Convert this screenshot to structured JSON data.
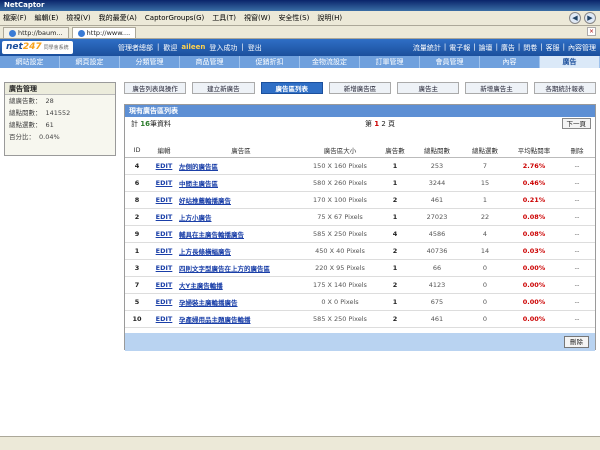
{
  "window": {
    "title": "NetCaptor"
  },
  "menu": [
    "檔案(F)",
    "編輯(E)",
    "檢視(V)",
    "我的最愛(A)",
    "CaptorGroups(G)",
    "工具(T)",
    "視窗(W)",
    "安全性(S)",
    "說明(H)"
  ],
  "browser_tabs": [
    {
      "label": "http://baum..."
    },
    {
      "label": "http://www...."
    }
  ],
  "header": {
    "logo_main": "net",
    "logo_num": "247",
    "logo_sub": "同學會系統",
    "system_name": "管理者總部",
    "sep": "|",
    "greeting_prefix": "歡迎",
    "username": "aileen",
    "greeting_suffix": "登入成功",
    "logout": "登出",
    "links": [
      "流量統計",
      "|",
      "電子報",
      "|",
      "論壇",
      "|",
      "廣告",
      "|",
      "問卷",
      "|",
      "客服",
      "|",
      "內容管理"
    ]
  },
  "main_nav": [
    "網站設定",
    "網頁設定",
    "分類管理",
    "商品管理",
    "促銷折扣",
    "金物流設定",
    "訂單管理",
    "會員管理",
    "內容",
    "廣告"
  ],
  "sidebar": {
    "title": "廣告管理",
    "rows": [
      {
        "label": "總廣告數：",
        "value": "28"
      },
      {
        "label": "總點閱數：",
        "value": "141552"
      },
      {
        "label": "總點選數：",
        "value": "61"
      },
      {
        "label": "百分比：",
        "value": "0.04%"
      }
    ]
  },
  "subtabs": [
    "廣告列表與操作",
    "建立新廣告",
    "廣告區列表",
    "新增廣告區",
    "廣告主",
    "新增廣告主",
    "各期統計報表"
  ],
  "panel": {
    "title": "現有廣告區列表",
    "count_prefix": "計",
    "count_value": "16",
    "count_suffix": "筆資料",
    "page_prefix": "第",
    "page_current": "1",
    "page_other": "2",
    "page_suffix": "頁",
    "next_label": "下一頁",
    "delete_label": "刪除"
  },
  "table": {
    "headers": [
      "ID",
      "編輯",
      "廣告區",
      "廣告區大小",
      "廣告數",
      "總點閱數",
      "總點選數",
      "平均點閱率",
      "刪除"
    ],
    "rows": [
      {
        "id": "4",
        "edit": "EDIT",
        "name": "左側的廣告區",
        "size": "150 X 160 Pixels",
        "ads": "1",
        "views": "253",
        "clicks": "7",
        "rate": "2.76%",
        "del": "--"
      },
      {
        "id": "6",
        "edit": "EDIT",
        "name": "中間主廣告區",
        "size": "580 X 260 Pixels",
        "ads": "1",
        "views": "3244",
        "clicks": "15",
        "rate": "0.46%",
        "del": "--"
      },
      {
        "id": "8",
        "edit": "EDIT",
        "name": "好站推薦輪播廣告",
        "size": "170 X 100 Pixels",
        "ads": "2",
        "views": "461",
        "clicks": "1",
        "rate": "0.21%",
        "del": "--"
      },
      {
        "id": "2",
        "edit": "EDIT",
        "name": "上方小廣告",
        "size": "75 X 67 Pixels",
        "ads": "1",
        "views": "27023",
        "clicks": "22",
        "rate": "0.08%",
        "del": "--"
      },
      {
        "id": "9",
        "edit": "EDIT",
        "name": "輔具在主廣告輪播廣告",
        "size": "585 X 250 Pixels",
        "ads": "4",
        "views": "4586",
        "clicks": "4",
        "rate": "0.08%",
        "del": "--"
      },
      {
        "id": "1",
        "edit": "EDIT",
        "name": "上方長條橫幅廣告",
        "size": "450 X 40 Pixels",
        "ads": "2",
        "views": "40736",
        "clicks": "14",
        "rate": "0.03%",
        "del": "--"
      },
      {
        "id": "3",
        "edit": "EDIT",
        "name": "四則文字型廣告在上方的廣告區",
        "size": "220 X 95 Pixels",
        "ads": "1",
        "views": "66",
        "clicks": "0",
        "rate": "0.00%",
        "del": "--"
      },
      {
        "id": "7",
        "edit": "EDIT",
        "name": "大Y主廣告輪播",
        "size": "175 X 140 Pixels",
        "ads": "2",
        "views": "4123",
        "clicks": "0",
        "rate": "0.00%",
        "del": "--"
      },
      {
        "id": "5",
        "edit": "EDIT",
        "name": "孕婦裝主廣輪播廣告",
        "size": "0 X 0 Pixels",
        "ads": "1",
        "views": "675",
        "clicks": "0",
        "rate": "0.00%",
        "del": "--"
      },
      {
        "id": "10",
        "edit": "EDIT",
        "name": "孕產婦用品主題廣告輪播",
        "size": "585 X 250 Pixels",
        "ads": "2",
        "views": "461",
        "clicks": "0",
        "rate": "0.00%",
        "del": "--"
      }
    ]
  }
}
